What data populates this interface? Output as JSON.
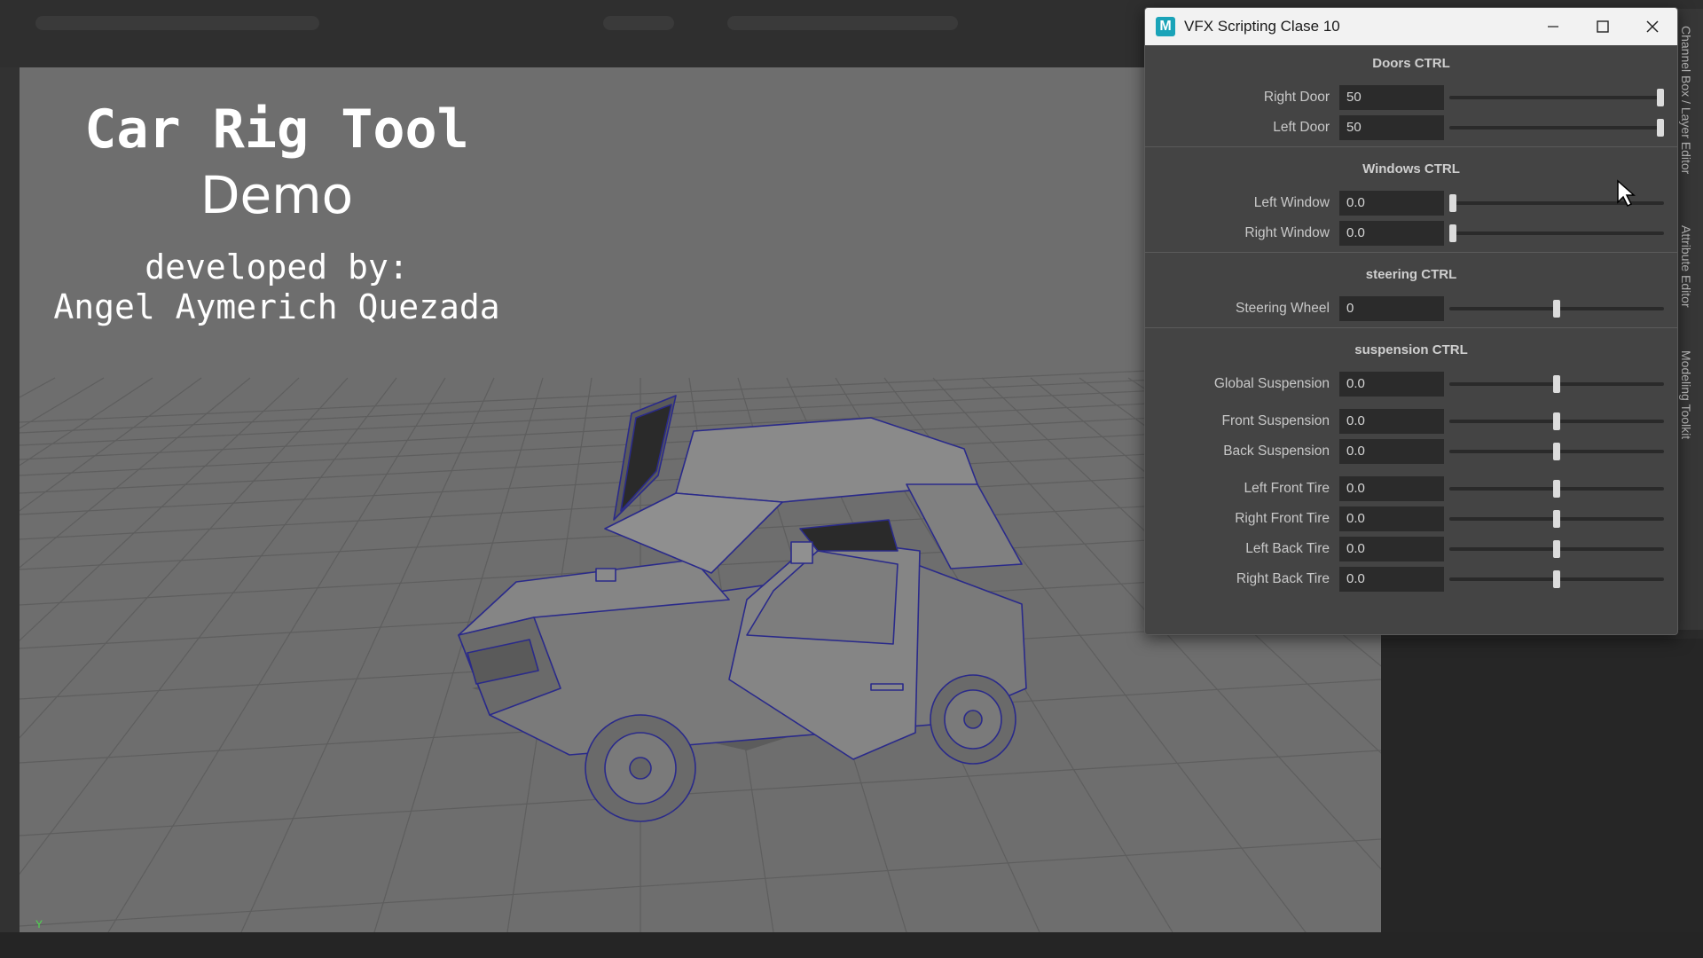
{
  "viewport": {
    "title": "Car Rig Tool",
    "subtitle": "Demo",
    "credit_line1": "developed by:",
    "credit_line2": "Angel Aymerich Quezada",
    "axis_label": "Y"
  },
  "side_tabs": [
    "Channel Box / Layer Editor",
    "Attribute Editor",
    "Modeling Toolkit"
  ],
  "window": {
    "title": "VFX Scripting Clase 10",
    "icon": "maya-app-icon",
    "sections": [
      {
        "title": "Doors CTRL",
        "rows": [
          {
            "label": "Right Door",
            "value": "50",
            "slider": 1.0
          },
          {
            "label": "Left Door",
            "value": "50",
            "slider": 1.0
          }
        ]
      },
      {
        "title": "Windows CTRL",
        "rows": [
          {
            "label": "Left Window",
            "value": "0.0",
            "slider": 0.0
          },
          {
            "label": "Right Window",
            "value": "0.0",
            "slider": 0.0
          }
        ]
      },
      {
        "title": "steering CTRL",
        "rows": [
          {
            "label": "Steering Wheel",
            "value": "0",
            "slider": 0.5
          }
        ]
      },
      {
        "title": "suspension CTRL",
        "rows": [
          {
            "label": "Global Suspension",
            "value": "0.0",
            "slider": 0.5
          },
          {
            "label": "Front Suspension",
            "value": "0.0",
            "slider": 0.5
          },
          {
            "label": "Back Suspension",
            "value": "0.0",
            "slider": 0.5
          },
          {
            "label": "Left Front Tire",
            "value": "0.0",
            "slider": 0.5
          },
          {
            "label": "Right Front Tire",
            "value": "0.0",
            "slider": 0.5
          },
          {
            "label": "Left Back Tire",
            "value": "0.0",
            "slider": 0.5
          },
          {
            "label": "Right Back Tire",
            "value": "0.0",
            "slider": 0.5
          }
        ]
      }
    ]
  },
  "colors": {
    "viewport_bg": "#6e6e6e",
    "panel_bg": "#444444",
    "field_bg": "#2b2b2b",
    "wireframe": "#2a2a8a"
  }
}
